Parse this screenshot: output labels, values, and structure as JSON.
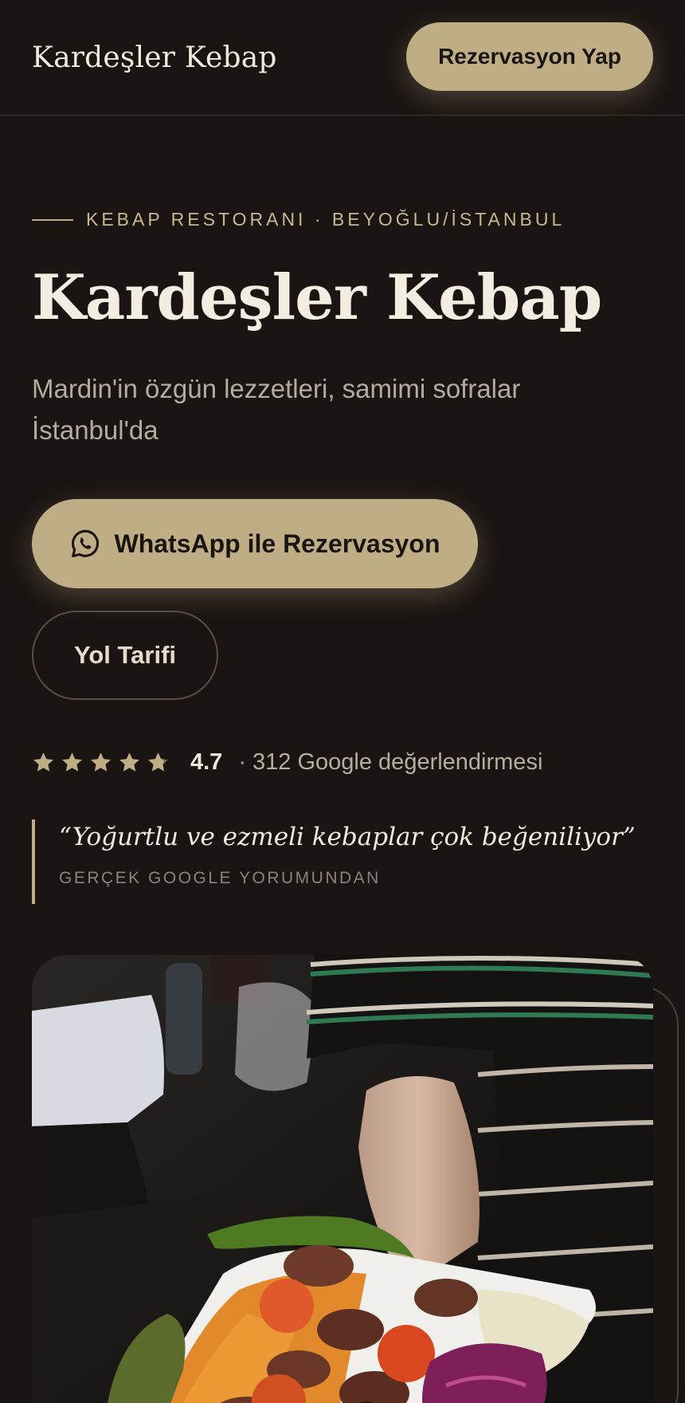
{
  "header": {
    "brand": "Kardeşler Kebap",
    "reserve_label": "Rezervasyon Yap"
  },
  "hero": {
    "eyebrow": "KEBAP RESTORANI · BEYOĞLU/İSTANBUL",
    "title": "Kardeşler Kebap",
    "subtitle": "Mardin'in özgün lezzetleri, samimi sofralar İstanbul'da",
    "whatsapp_label": "WhatsApp ile Rezervasyon",
    "directions_label": "Yol Tarifi"
  },
  "rating": {
    "stars": 5,
    "score": "4.7",
    "count_text": "· 312 Google değerlendirmesi"
  },
  "quote": {
    "text": "“Yoğurtlu ve ezmeli kebaplar çok beğeniliyor”",
    "source": "GERÇEK GOOGLE YORUMUNDAN"
  },
  "colors": {
    "background": "#1a1412",
    "accent": "#bfae85",
    "text": "#efe8dc"
  },
  "icons": {
    "whatsapp": "whatsapp-icon",
    "star": "star-icon"
  }
}
